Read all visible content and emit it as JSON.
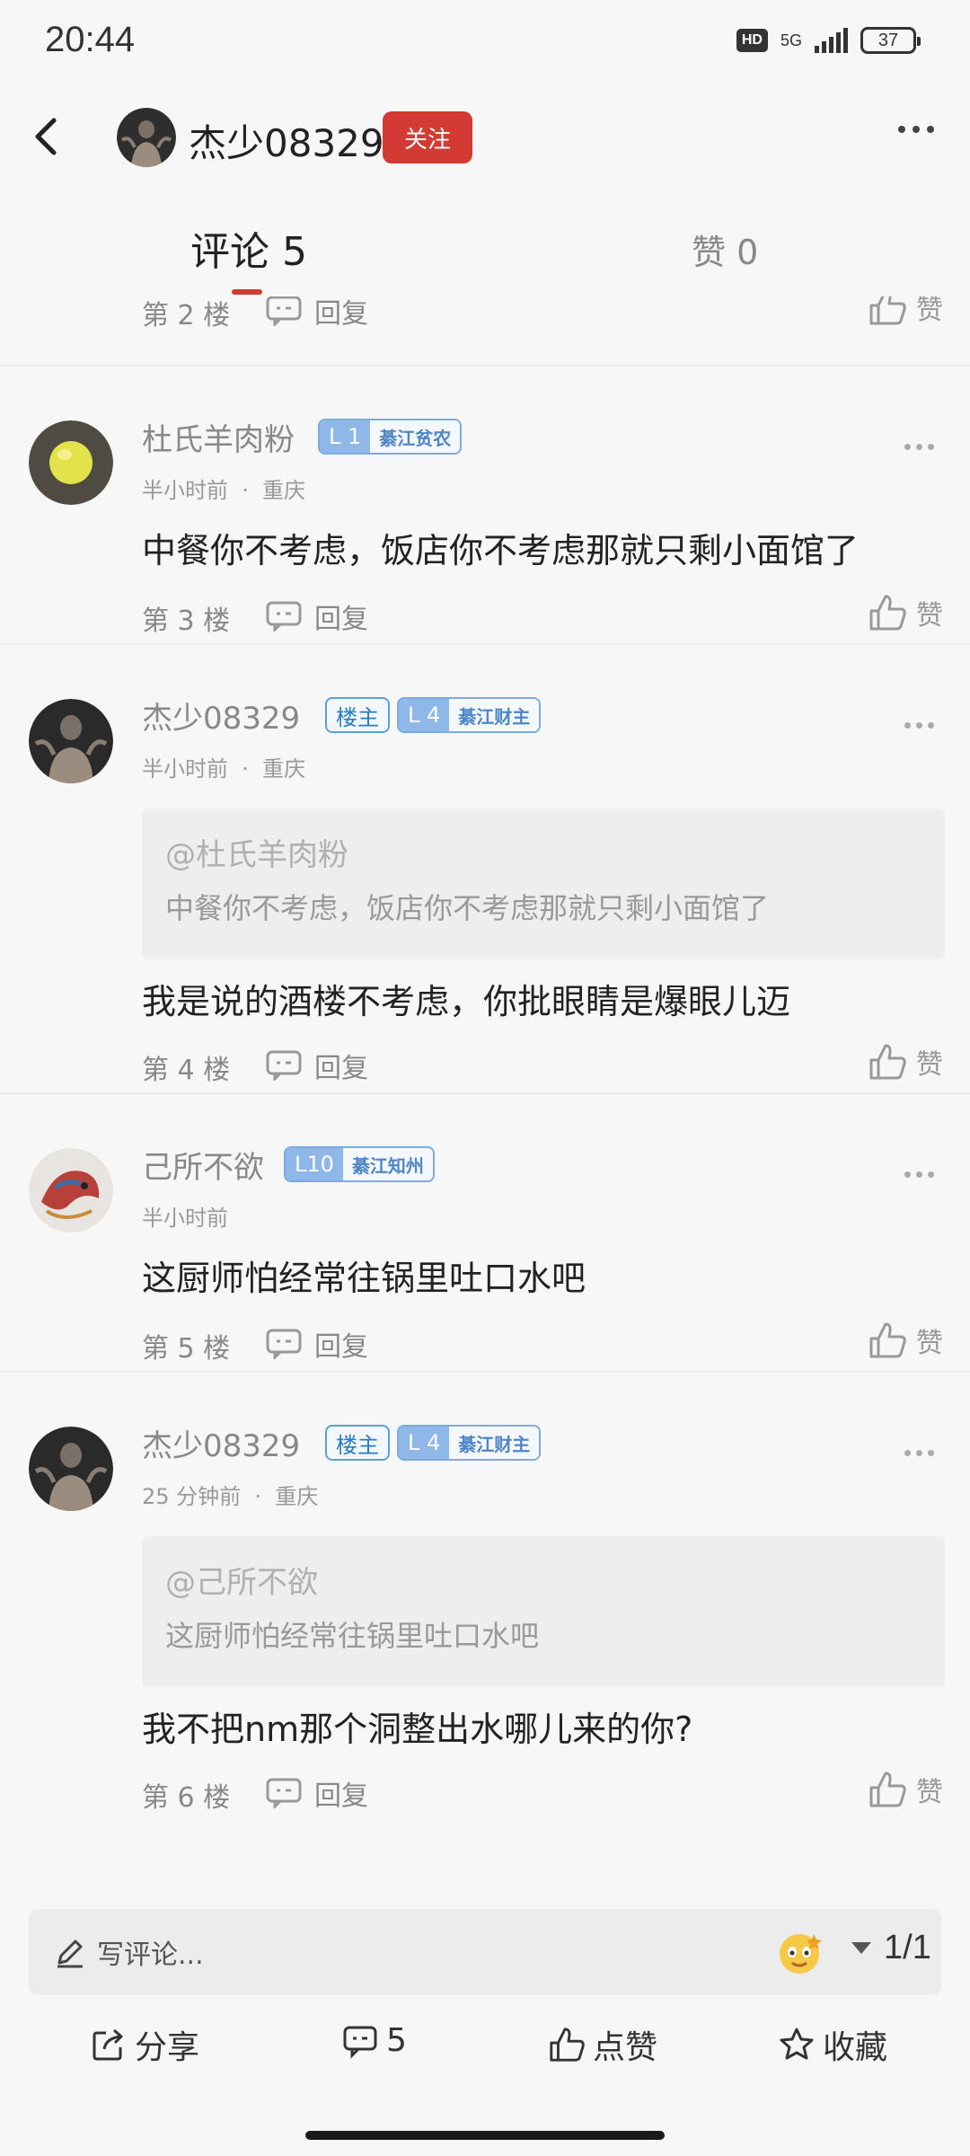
{
  "status": {
    "time": "20:44",
    "hd": "HD",
    "network": "5G",
    "battery": "37"
  },
  "header": {
    "username": "杰少08329",
    "follow_label": "关注"
  },
  "tabs": {
    "comments_label": "评论 5",
    "likes_label": "赞 0"
  },
  "actions": {
    "reply_label": "回复",
    "like_label": "赞"
  },
  "floors": [
    "第 2 楼",
    "第 3 楼",
    "第 4 楼",
    "第 5 楼",
    "第 6 楼"
  ],
  "comments": [
    {
      "user": "杜氏羊肉粉",
      "owner_label": "",
      "level": "L 1",
      "title": "綦江贫农",
      "time": "半小时前",
      "location": "重庆",
      "text": "中餐你不考虑，饭店你不考虑那就只剩小面馆了"
    },
    {
      "user": "杰少08329",
      "owner_label": "楼主",
      "level": "L 4",
      "title": "綦江财主",
      "time": "半小时前",
      "location": "重庆",
      "quote_user": "@杜氏羊肉粉",
      "quote_text": "中餐你不考虑，饭店你不考虑那就只剩小面馆了",
      "text": "我是说的酒楼不考虑，你批眼睛是爆眼儿迈"
    },
    {
      "user": "己所不欲",
      "owner_label": "",
      "level": "L10",
      "title": "綦江知州",
      "time": "半小时前",
      "location": "",
      "text": "这厨师怕经常往锅里吐口水吧"
    },
    {
      "user": "杰少08329",
      "owner_label": "楼主",
      "level": "L 4",
      "title": "綦江财主",
      "time": "25 分钟前",
      "location": "重庆",
      "quote_user": "@己所不欲",
      "quote_text": "这厨师怕经常往锅里吐口水吧",
      "text": "我不把nm那个洞整出水哪儿来的你?"
    }
  ],
  "bottom": {
    "input_placeholder": "写评论...",
    "page_indicator": "1/1",
    "share_label": "分享",
    "comment_count": "5",
    "like_label": "点赞",
    "favorite_label": "收藏"
  },
  "colors": {
    "accent": "#d23a33",
    "badge_blue": "#8fb8e8",
    "bg": "#f7f7f7"
  }
}
